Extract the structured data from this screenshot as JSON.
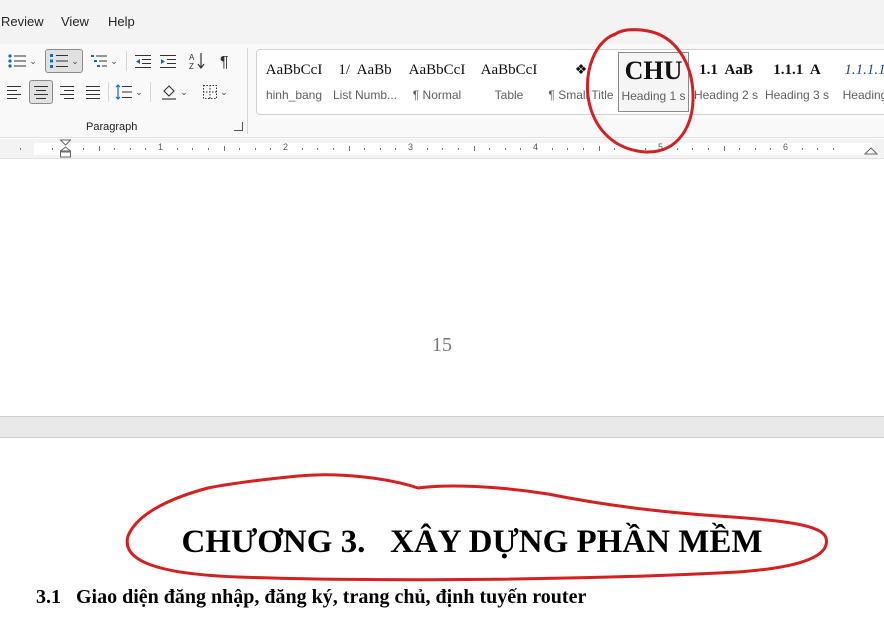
{
  "menu": {
    "tabs": [
      "Review",
      "View",
      "Help"
    ]
  },
  "ribbon": {
    "paragraph_group_label": "Paragraph",
    "styles": [
      {
        "preview": "AaBbCcI",
        "name": "hinh_bang"
      },
      {
        "preview": "1/  AaBb",
        "name": "List Numb..."
      },
      {
        "preview": "AaBbCcI",
        "name": "¶ Normal"
      },
      {
        "preview": "AaBbCcI",
        "name": "Table"
      },
      {
        "preview": "❖",
        "name": "¶ Small Title"
      },
      {
        "preview": "CHU",
        "name": "Heading 1 s"
      },
      {
        "preview": "1.1  AaB",
        "name": "Heading 2 s"
      },
      {
        "preview": "1.1.1  A",
        "name": "Heading 3 s"
      },
      {
        "preview": "1.1.1.1",
        "name": "Heading"
      }
    ]
  },
  "ruler": {
    "numbers": [
      "1",
      "2",
      "3",
      "4",
      "5",
      "6"
    ]
  },
  "document": {
    "page_number": "15",
    "chapter_heading": "CHƯƠNG 3.   XÂY DỰNG PHẦN MỀM",
    "subheading": "3.1   Giao diện đăng nhập, đăng ký, trang chủ, định tuyến router"
  },
  "colors": {
    "annotation": "#d62020",
    "accent": "#0f6cbd"
  }
}
